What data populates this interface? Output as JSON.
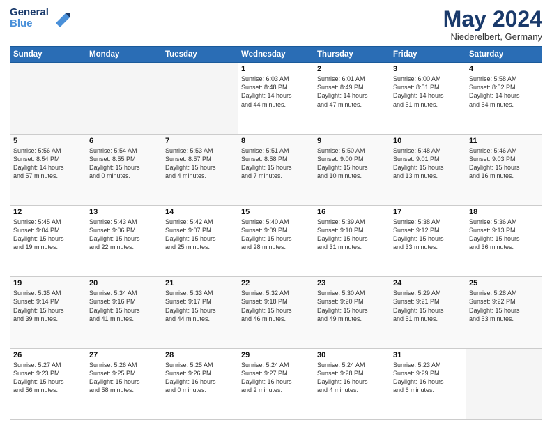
{
  "header": {
    "logo_line1": "General",
    "logo_line2": "Blue",
    "month_title": "May 2024",
    "location": "Niederelbert, Germany"
  },
  "days_of_week": [
    "Sunday",
    "Monday",
    "Tuesday",
    "Wednesday",
    "Thursday",
    "Friday",
    "Saturday"
  ],
  "weeks": [
    [
      {
        "day": "",
        "content": ""
      },
      {
        "day": "",
        "content": ""
      },
      {
        "day": "",
        "content": ""
      },
      {
        "day": "1",
        "content": "Sunrise: 6:03 AM\nSunset: 8:48 PM\nDaylight: 14 hours\nand 44 minutes."
      },
      {
        "day": "2",
        "content": "Sunrise: 6:01 AM\nSunset: 8:49 PM\nDaylight: 14 hours\nand 47 minutes."
      },
      {
        "day": "3",
        "content": "Sunrise: 6:00 AM\nSunset: 8:51 PM\nDaylight: 14 hours\nand 51 minutes."
      },
      {
        "day": "4",
        "content": "Sunrise: 5:58 AM\nSunset: 8:52 PM\nDaylight: 14 hours\nand 54 minutes."
      }
    ],
    [
      {
        "day": "5",
        "content": "Sunrise: 5:56 AM\nSunset: 8:54 PM\nDaylight: 14 hours\nand 57 minutes."
      },
      {
        "day": "6",
        "content": "Sunrise: 5:54 AM\nSunset: 8:55 PM\nDaylight: 15 hours\nand 0 minutes."
      },
      {
        "day": "7",
        "content": "Sunrise: 5:53 AM\nSunset: 8:57 PM\nDaylight: 15 hours\nand 4 minutes."
      },
      {
        "day": "8",
        "content": "Sunrise: 5:51 AM\nSunset: 8:58 PM\nDaylight: 15 hours\nand 7 minutes."
      },
      {
        "day": "9",
        "content": "Sunrise: 5:50 AM\nSunset: 9:00 PM\nDaylight: 15 hours\nand 10 minutes."
      },
      {
        "day": "10",
        "content": "Sunrise: 5:48 AM\nSunset: 9:01 PM\nDaylight: 15 hours\nand 13 minutes."
      },
      {
        "day": "11",
        "content": "Sunrise: 5:46 AM\nSunset: 9:03 PM\nDaylight: 15 hours\nand 16 minutes."
      }
    ],
    [
      {
        "day": "12",
        "content": "Sunrise: 5:45 AM\nSunset: 9:04 PM\nDaylight: 15 hours\nand 19 minutes."
      },
      {
        "day": "13",
        "content": "Sunrise: 5:43 AM\nSunset: 9:06 PM\nDaylight: 15 hours\nand 22 minutes."
      },
      {
        "day": "14",
        "content": "Sunrise: 5:42 AM\nSunset: 9:07 PM\nDaylight: 15 hours\nand 25 minutes."
      },
      {
        "day": "15",
        "content": "Sunrise: 5:40 AM\nSunset: 9:09 PM\nDaylight: 15 hours\nand 28 minutes."
      },
      {
        "day": "16",
        "content": "Sunrise: 5:39 AM\nSunset: 9:10 PM\nDaylight: 15 hours\nand 31 minutes."
      },
      {
        "day": "17",
        "content": "Sunrise: 5:38 AM\nSunset: 9:12 PM\nDaylight: 15 hours\nand 33 minutes."
      },
      {
        "day": "18",
        "content": "Sunrise: 5:36 AM\nSunset: 9:13 PM\nDaylight: 15 hours\nand 36 minutes."
      }
    ],
    [
      {
        "day": "19",
        "content": "Sunrise: 5:35 AM\nSunset: 9:14 PM\nDaylight: 15 hours\nand 39 minutes."
      },
      {
        "day": "20",
        "content": "Sunrise: 5:34 AM\nSunset: 9:16 PM\nDaylight: 15 hours\nand 41 minutes."
      },
      {
        "day": "21",
        "content": "Sunrise: 5:33 AM\nSunset: 9:17 PM\nDaylight: 15 hours\nand 44 minutes."
      },
      {
        "day": "22",
        "content": "Sunrise: 5:32 AM\nSunset: 9:18 PM\nDaylight: 15 hours\nand 46 minutes."
      },
      {
        "day": "23",
        "content": "Sunrise: 5:30 AM\nSunset: 9:20 PM\nDaylight: 15 hours\nand 49 minutes."
      },
      {
        "day": "24",
        "content": "Sunrise: 5:29 AM\nSunset: 9:21 PM\nDaylight: 15 hours\nand 51 minutes."
      },
      {
        "day": "25",
        "content": "Sunrise: 5:28 AM\nSunset: 9:22 PM\nDaylight: 15 hours\nand 53 minutes."
      }
    ],
    [
      {
        "day": "26",
        "content": "Sunrise: 5:27 AM\nSunset: 9:23 PM\nDaylight: 15 hours\nand 56 minutes."
      },
      {
        "day": "27",
        "content": "Sunrise: 5:26 AM\nSunset: 9:25 PM\nDaylight: 15 hours\nand 58 minutes."
      },
      {
        "day": "28",
        "content": "Sunrise: 5:25 AM\nSunset: 9:26 PM\nDaylight: 16 hours\nand 0 minutes."
      },
      {
        "day": "29",
        "content": "Sunrise: 5:24 AM\nSunset: 9:27 PM\nDaylight: 16 hours\nand 2 minutes."
      },
      {
        "day": "30",
        "content": "Sunrise: 5:24 AM\nSunset: 9:28 PM\nDaylight: 16 hours\nand 4 minutes."
      },
      {
        "day": "31",
        "content": "Sunrise: 5:23 AM\nSunset: 9:29 PM\nDaylight: 16 hours\nand 6 minutes."
      },
      {
        "day": "",
        "content": ""
      }
    ]
  ]
}
